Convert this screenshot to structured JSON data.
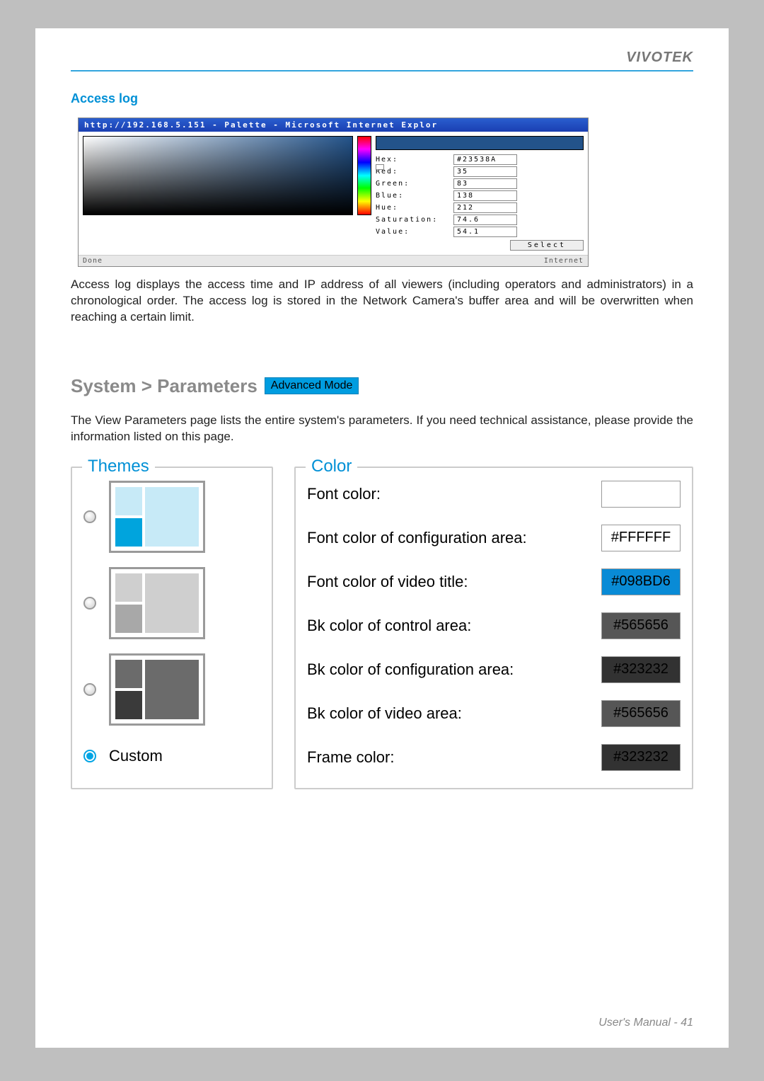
{
  "brand": "VIVOTEK",
  "access_log": {
    "heading": "Access log",
    "palette_window": {
      "title": "http://192.168.5.151 - Palette - Microsoft Internet Explor",
      "status_left": "Done",
      "status_right": "Internet",
      "preview_color": "#23538A",
      "readout": {
        "hex_label": "Hex:",
        "hex": "#23538A",
        "red_label": "Red:",
        "red": "35",
        "green_label": "Green:",
        "green": "83",
        "blue_label": "Blue:",
        "blue": "138",
        "hue_label": "Hue:",
        "hue": "212",
        "sat_label": "Saturation:",
        "sat": "74.6",
        "val_label": "Value:",
        "val": "54.1"
      },
      "select_btn": "Select"
    },
    "body": "Access log displays the access time and IP address of all viewers (including operators and administrators) in a chronological order. The access log is stored in the Network Camera's buffer area and will be overwritten when reaching a certain limit."
  },
  "parameters": {
    "heading": "System > Parameters",
    "badge": "Advanced Mode",
    "body": "The View Parameters page lists the entire system's parameters. If you need technical assistance, please provide the information listed on this page."
  },
  "themes_panel": {
    "legend": "Themes",
    "custom_label": "Custom"
  },
  "color_panel": {
    "legend": "Color",
    "rows": [
      {
        "label": "Font color:",
        "value": "",
        "bg": "#ffffff",
        "fg": "#000000"
      },
      {
        "label": "Font color of configuration area:",
        "value": "#FFFFFF",
        "bg": "#ffffff",
        "fg": "#000000"
      },
      {
        "label": "Font color of video title:",
        "value": "#098BD6",
        "bg": "#098BD6",
        "fg": "#000000"
      },
      {
        "label": "Bk color of control area:",
        "value": "#565656",
        "bg": "#565656",
        "fg": "#000000"
      },
      {
        "label": "Bk color of configuration area:",
        "value": "#323232",
        "bg": "#323232",
        "fg": "#000000"
      },
      {
        "label": "Bk color of video area:",
        "value": "#565656",
        "bg": "#565656",
        "fg": "#000000"
      },
      {
        "label": "Frame color:",
        "value": "#323232",
        "bg": "#323232",
        "fg": "#000000"
      }
    ]
  },
  "footer": "User's Manual - 41"
}
